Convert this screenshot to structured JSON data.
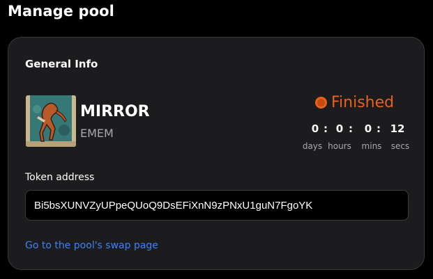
{
  "page": {
    "title": "Manage pool"
  },
  "card": {
    "section_title": "General Info",
    "token": {
      "name": "MIRROR",
      "symbol": "EMEM"
    },
    "status": {
      "label": "Finished",
      "color": "#e8611d"
    },
    "countdown": {
      "days": "0",
      "hours": "0",
      "mins": "0",
      "secs": "12",
      "separator": ":",
      "labels": {
        "days": "days",
        "hours": "hours",
        "mins": "mins",
        "secs": "secs"
      }
    },
    "address": {
      "label": "Token address",
      "value": "Bi5bsXUNVZyUPpeQUoQ9DsEFiXnN9zPNxU1guN7FgoYK"
    },
    "swap_link": "Go to the pool's swap page"
  },
  "colors": {
    "background": "#000000",
    "card": "#1c1b1d",
    "accent_status": "#e8611d",
    "link": "#3b82f6"
  }
}
